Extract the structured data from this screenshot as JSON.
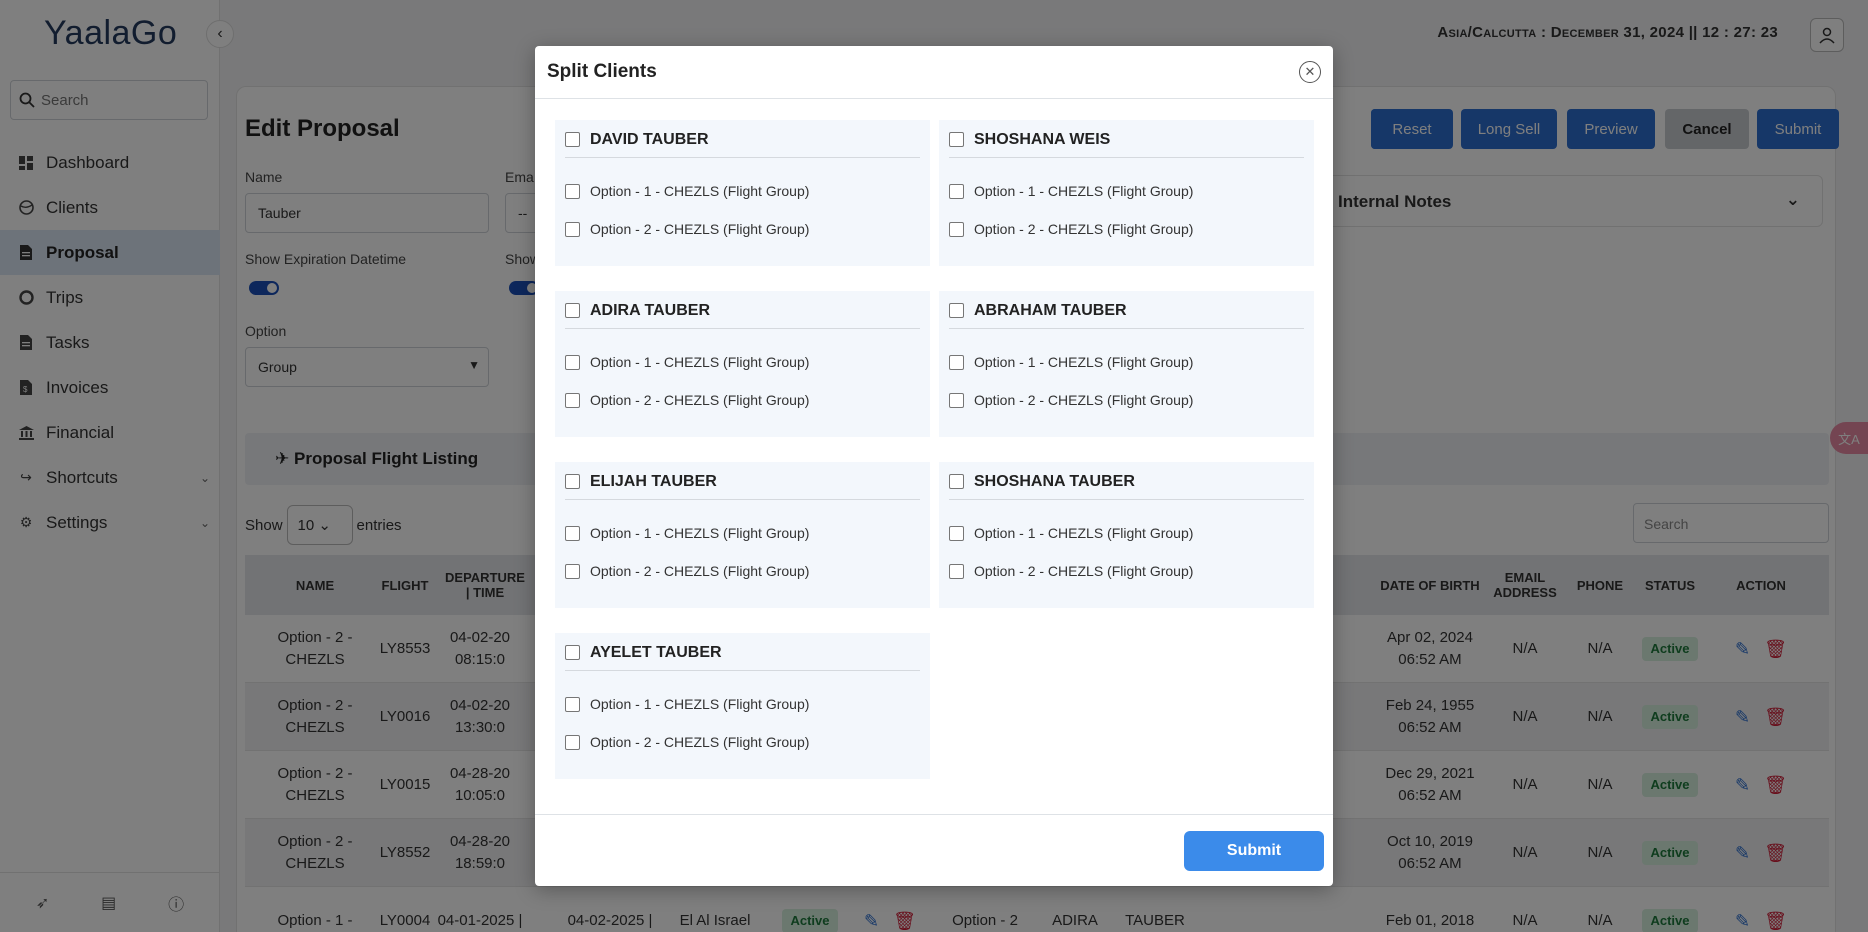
{
  "app": {
    "logo": "YaalaGo"
  },
  "sidebar": {
    "search_placeholder": "Search",
    "items": [
      {
        "label": "Dashboard",
        "icon": "dashboard-icon"
      },
      {
        "label": "Clients",
        "icon": "globe-icon"
      },
      {
        "label": "Proposal",
        "icon": "document-icon",
        "active": true
      },
      {
        "label": "Trips",
        "icon": "circle-icon"
      },
      {
        "label": "Tasks",
        "icon": "document-icon"
      },
      {
        "label": "Invoices",
        "icon": "invoice-icon"
      },
      {
        "label": "Financial",
        "icon": "bank-icon"
      },
      {
        "label": "Shortcuts",
        "icon": "share-icon"
      },
      {
        "label": "Settings",
        "icon": "gear-icon"
      }
    ]
  },
  "topbar": {
    "datetime": "Asia/Calcutta : December 31, 2024 || 12 : 27: 23"
  },
  "page": {
    "title": "Edit Proposal",
    "name_label": "Name",
    "name_value": "Tauber",
    "email_label": "Ema",
    "email_value": "--",
    "show_expiration_label": "Show Expiration Datetime",
    "show2_label": "Show",
    "option_label": "Option",
    "option_value": "Group",
    "buttons": {
      "reset": "Reset",
      "long_sell": "Long Sell",
      "preview": "Preview",
      "cancel": "Cancel",
      "submit": "Submit"
    },
    "internal_notes": "Internal Notes",
    "listing_title": "Proposal Flight Listing",
    "show": "Show",
    "entries_value": "10",
    "entries": "entries",
    "table_search_placeholder": "Search"
  },
  "table": {
    "headers": [
      "NAME",
      "FLIGHT",
      "DEPARTURE | TIME",
      "DATE OF BIRTH",
      "EMAIL ADDRESS",
      "PHONE",
      "STATUS",
      "ACTION"
    ],
    "rows": [
      {
        "name": "Option - 2 - CHEZLS",
        "flight": "LY8553",
        "dep": "04-02-20 08:15:0",
        "dob": "Apr 02, 2024 06:52 AM",
        "email": "N/A",
        "phone": "N/A",
        "status": "Active"
      },
      {
        "name": "Option - 2 - CHEZLS",
        "flight": "LY0016",
        "dep": "04-02-20 13:30:0",
        "dob": "Feb 24, 1955 06:52 AM",
        "email": "N/A",
        "phone": "N/A",
        "status": "Active"
      },
      {
        "name": "Option - 2 - CHEZLS",
        "flight": "LY0015",
        "dep": "04-28-20 10:05:0",
        "dob": "Dec 29, 2021 06:52 AM",
        "email": "N/A",
        "phone": "N/A",
        "status": "Active"
      },
      {
        "name": "Option - 2 - CHEZLS",
        "flight": "LY8552",
        "dep": "04-28-20 18:59:0",
        "dob": "Oct 10, 2019 06:52 AM",
        "email": "N/A",
        "phone": "N/A",
        "status": "Active"
      },
      {
        "name": "Option - 1 -",
        "flight": "LY0004",
        "dep": "04-01-2025 |",
        "dob": "Feb 01, 2018",
        "email": "N/A",
        "phone": "N/A",
        "status": "Active",
        "extra_arr": "04-02-2025 |",
        "extra_airline": "El Al Israel",
        "extra_status": "Active",
        "extra_opt": "Option - 2",
        "extra_first": "ADIRA",
        "extra_last": "TAUBER"
      }
    ]
  },
  "modal": {
    "title": "Split Clients",
    "submit": "Submit",
    "clients": [
      {
        "name": "DAVID TAUBER",
        "options": [
          "Option - 1 - CHEZLS (Flight Group)",
          "Option - 2 - CHEZLS (Flight Group)"
        ]
      },
      {
        "name": "SHOSHANA WEIS",
        "options": [
          "Option - 1 - CHEZLS (Flight Group)",
          "Option - 2 - CHEZLS (Flight Group)"
        ]
      },
      {
        "name": "ADIRA TAUBER",
        "options": [
          "Option - 1 - CHEZLS (Flight Group)",
          "Option - 2 - CHEZLS (Flight Group)"
        ]
      },
      {
        "name": "ABRAHAM TAUBER",
        "options": [
          "Option - 1 - CHEZLS (Flight Group)",
          "Option - 2 - CHEZLS (Flight Group)"
        ]
      },
      {
        "name": "ELIJAH TAUBER",
        "options": [
          "Option - 1 - CHEZLS (Flight Group)",
          "Option - 2 - CHEZLS (Flight Group)"
        ]
      },
      {
        "name": "SHOSHANA TAUBER",
        "options": [
          "Option - 1 - CHEZLS (Flight Group)",
          "Option - 2 - CHEZLS (Flight Group)"
        ]
      },
      {
        "name": "AYELET TAUBER",
        "options": [
          "Option - 1 - CHEZLS (Flight Group)",
          "Option - 2 - CHEZLS (Flight Group)"
        ]
      }
    ]
  },
  "colors": {
    "primary": "#2c6fd0",
    "active_nav": "#dbe6f5",
    "submit": "#3b8bea",
    "danger": "#d0213a",
    "badge_bg": "#d7f0df"
  }
}
